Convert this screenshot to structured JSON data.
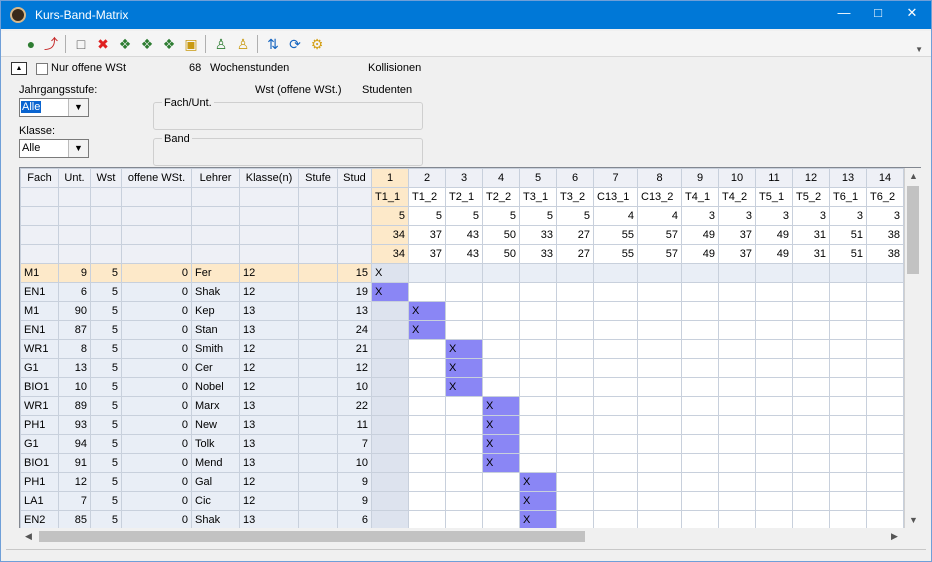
{
  "window": {
    "title": "Kurs-Band-Matrix"
  },
  "toolbar": {
    "buttons": [
      "add-icon",
      "link-icon",
      "new-doc-icon",
      "delete-icon",
      "grid-icon",
      "grid-alt-icon",
      "grid-lock-icon",
      "lock-icon",
      "people-icon",
      "people-alt-icon",
      "sort-icon",
      "refresh-icon",
      "settings-icon"
    ]
  },
  "filter": {
    "only_open_label": "Nur offene WSt",
    "hours_count": "68",
    "hours_label": "Wochenstunden",
    "collisions_label": "Kollisionen",
    "jahrgang_label": "Jahrgangsstufe:",
    "jahrgang_value": "Alle",
    "klasse_label": "Klasse:",
    "klasse_value": "Alle",
    "wst_label": "Wst (offene WSt.)",
    "studenten_label": "Studenten",
    "fach_group_label": "Fach/Unt.",
    "band_group_label": "Band"
  },
  "colors": {
    "accent": "#0078d7",
    "highlight": "#fde9c9",
    "mark": "#8a86f5",
    "alt_row": "#e9eef6"
  },
  "grid": {
    "headers": [
      "Fach",
      "Unt.",
      "Wst",
      "offene WSt.",
      "Lehrer",
      "Klasse(n)",
      "Stufe",
      "Stud"
    ],
    "band_numbers": [
      "1",
      "2",
      "3",
      "4",
      "5",
      "6",
      "7",
      "8",
      "9",
      "10",
      "11",
      "12",
      "13",
      "14"
    ],
    "band_names": [
      "T1_1",
      "T1_2",
      "T2_1",
      "T2_2",
      "T3_1",
      "T3_2",
      "C13_1",
      "C13_2",
      "T4_1",
      "T4_2",
      "T5_1",
      "T5_2",
      "T6_1",
      "T6_2"
    ],
    "band_wst": [
      "5",
      "5",
      "5",
      "5",
      "5",
      "5",
      "4",
      "4",
      "3",
      "3",
      "3",
      "3",
      "3",
      "3"
    ],
    "band_studs_a": [
      "34",
      "37",
      "43",
      "50",
      "33",
      "27",
      "55",
      "57",
      "49",
      "37",
      "49",
      "31",
      "51",
      "38"
    ],
    "band_studs_b": [
      "34",
      "37",
      "43",
      "50",
      "33",
      "27",
      "55",
      "57",
      "49",
      "37",
      "49",
      "31",
      "51",
      "38"
    ],
    "mark_symbol": "X",
    "rows": [
      {
        "fach": "M1",
        "unt": "9",
        "wst": "5",
        "offen": "0",
        "lehrer": "Fer",
        "klasse": "12",
        "stufe": "",
        "stud": "15",
        "band": 0
      },
      {
        "fach": "EN1",
        "unt": "6",
        "wst": "5",
        "offen": "0",
        "lehrer": "Shak",
        "klasse": "12",
        "stufe": "",
        "stud": "19",
        "band": 0
      },
      {
        "fach": "M1",
        "unt": "90",
        "wst": "5",
        "offen": "0",
        "lehrer": "Kep",
        "klasse": "13",
        "stufe": "",
        "stud": "13",
        "band": 1
      },
      {
        "fach": "EN1",
        "unt": "87",
        "wst": "5",
        "offen": "0",
        "lehrer": "Stan",
        "klasse": "13",
        "stufe": "",
        "stud": "24",
        "band": 1
      },
      {
        "fach": "WR1",
        "unt": "8",
        "wst": "5",
        "offen": "0",
        "lehrer": "Smith",
        "klasse": "12",
        "stufe": "",
        "stud": "21",
        "band": 2
      },
      {
        "fach": "G1",
        "unt": "13",
        "wst": "5",
        "offen": "0",
        "lehrer": "Cer",
        "klasse": "12",
        "stufe": "",
        "stud": "12",
        "band": 2
      },
      {
        "fach": "BIO1",
        "unt": "10",
        "wst": "5",
        "offen": "0",
        "lehrer": "Nobel",
        "klasse": "12",
        "stufe": "",
        "stud": "10",
        "band": 2
      },
      {
        "fach": "WR1",
        "unt": "89",
        "wst": "5",
        "offen": "0",
        "lehrer": "Marx",
        "klasse": "13",
        "stufe": "",
        "stud": "22",
        "band": 3
      },
      {
        "fach": "PH1",
        "unt": "93",
        "wst": "5",
        "offen": "0",
        "lehrer": "New",
        "klasse": "13",
        "stufe": "",
        "stud": "11",
        "band": 3
      },
      {
        "fach": "G1",
        "unt": "94",
        "wst": "5",
        "offen": "0",
        "lehrer": "Tolk",
        "klasse": "13",
        "stufe": "",
        "stud": "7",
        "band": 3
      },
      {
        "fach": "BIO1",
        "unt": "91",
        "wst": "5",
        "offen": "0",
        "lehrer": "Mend",
        "klasse": "13",
        "stufe": "",
        "stud": "10",
        "band": 3
      },
      {
        "fach": "PH1",
        "unt": "12",
        "wst": "5",
        "offen": "0",
        "lehrer": "Gal",
        "klasse": "12",
        "stufe": "",
        "stud": "9",
        "band": 4
      },
      {
        "fach": "LA1",
        "unt": "7",
        "wst": "5",
        "offen": "0",
        "lehrer": "Cic",
        "klasse": "12",
        "stufe": "",
        "stud": "9",
        "band": 4
      },
      {
        "fach": "EN2",
        "unt": "85",
        "wst": "5",
        "offen": "0",
        "lehrer": "Shak",
        "klasse": "13",
        "stufe": "",
        "stud": "6",
        "band": 4
      }
    ]
  }
}
